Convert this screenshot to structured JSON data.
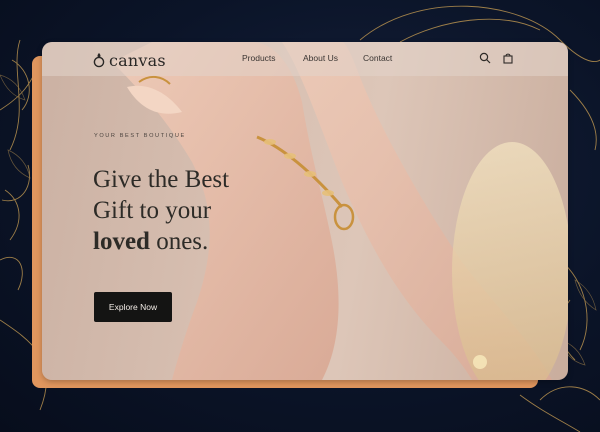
{
  "brand": {
    "name": "canvas",
    "logo_icon": "flame-ring-icon"
  },
  "nav": {
    "links": [
      {
        "label": "Products"
      },
      {
        "label": "About Us"
      },
      {
        "label": "Contact"
      }
    ],
    "icons": [
      "search-icon",
      "shopping-bag-icon"
    ]
  },
  "hero": {
    "eyebrow": "YOUR BEST BOUTIQUE",
    "line1": "Give the Best",
    "line2": "Gift to your",
    "line3_bold": "loved",
    "line3_rest": " ones.",
    "cta_label": "Explore Now"
  },
  "colors": {
    "accent_orange": "#e0965e",
    "page_navy": "#0b1428",
    "gold_line": "#b8924f",
    "button_dark": "#141413"
  }
}
